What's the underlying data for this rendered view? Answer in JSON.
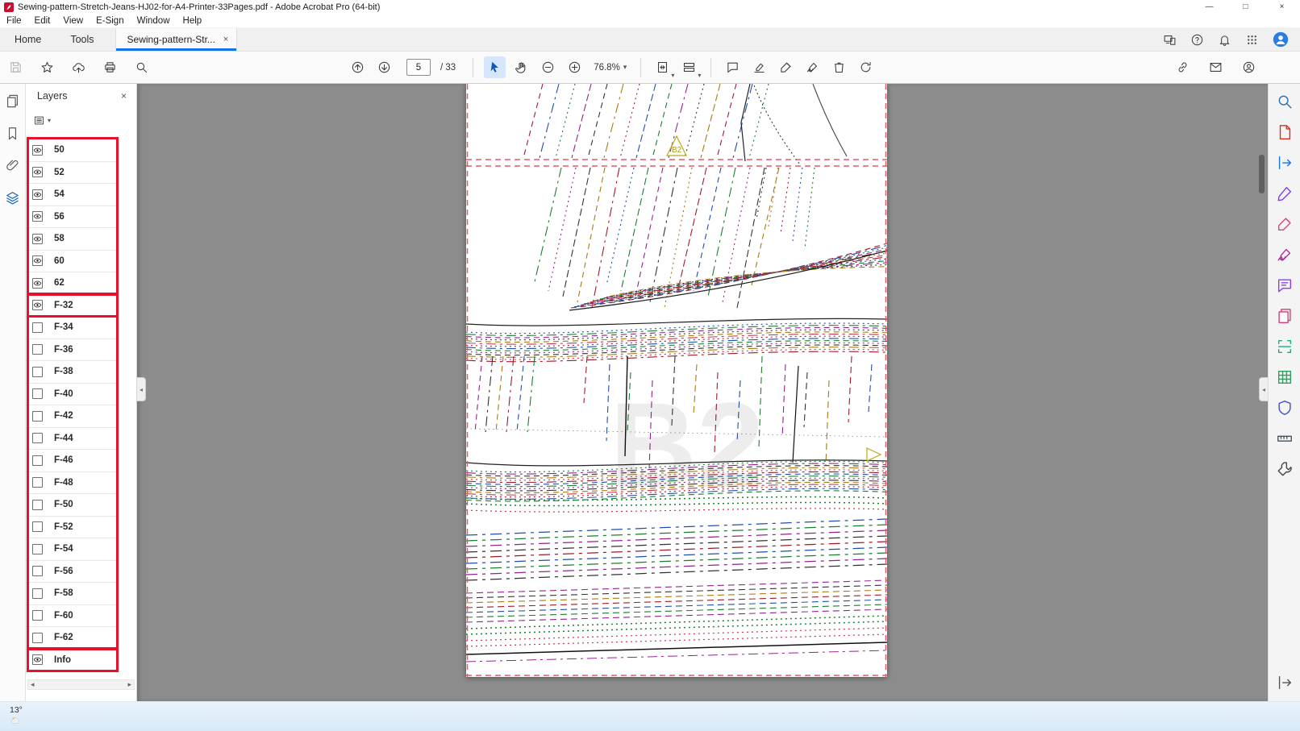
{
  "window": {
    "title": "Sewing-pattern-Stretch-Jeans-HJ02-for-A4-Printer-33Pages.pdf - Adobe Acrobat Pro (64-bit)",
    "controls": {
      "minimize": "—",
      "maximize": "□",
      "close": "×"
    }
  },
  "glyphs": {
    "caret_down": "▾",
    "collapse_left": "◂",
    "scroll_left": "◂",
    "scroll_right": "▸",
    "close": "×"
  },
  "menu_bar": {
    "items": [
      "File",
      "Edit",
      "View",
      "E-Sign",
      "Window",
      "Help"
    ]
  },
  "tab_bar": {
    "home_label": "Home",
    "tools_label": "Tools",
    "document_tab": "Sewing-pattern-Str...",
    "right_icons": [
      {
        "name": "devices-icon",
        "icon": "devices"
      },
      {
        "name": "help-icon",
        "icon": "help"
      },
      {
        "name": "notifications-bell-icon",
        "icon": "bell"
      },
      {
        "name": "apps-grid-icon",
        "icon": "grid9"
      },
      {
        "name": "user-avatar",
        "icon": "avatar"
      }
    ]
  },
  "toolbar": {
    "left_icons": [
      {
        "name": "save-button",
        "icon": "floppy",
        "disabled": true
      },
      {
        "name": "favorites-star-button",
        "icon": "star"
      },
      {
        "name": "share-cloud-button",
        "icon": "cloudup"
      },
      {
        "name": "print-button",
        "icon": "printer"
      },
      {
        "name": "find-button",
        "icon": "magnifier"
      }
    ],
    "nav": {
      "previous": {
        "name": "previous-page-button",
        "icon": "upcircle"
      },
      "next": {
        "name": "next-page-button",
        "icon": "downcircle"
      },
      "current_page": "5",
      "total_pages": "/ 33"
    },
    "tools": [
      {
        "name": "select-tool-button",
        "icon": "cursor",
        "active": true
      },
      {
        "name": "hand-tool-button",
        "icon": "hand"
      },
      {
        "name": "zoom-out-button",
        "icon": "minuscircle"
      },
      {
        "name": "zoom-in-button",
        "icon": "pluscircle"
      }
    ],
    "zoom_level": "76.8%",
    "view_icons": [
      {
        "name": "fit-width-button",
        "icon": "fitpage",
        "caret": true
      },
      {
        "name": "page-display-button",
        "icon": "rows",
        "caret": true
      }
    ],
    "action_icons": [
      {
        "name": "add-comment-button",
        "icon": "comment"
      },
      {
        "name": "highlight-button",
        "icon": "highlighter"
      },
      {
        "name": "sign-button",
        "icon": "signpen"
      },
      {
        "name": "draw-button",
        "icon": "inkpen"
      },
      {
        "name": "delete-button",
        "icon": "trash"
      },
      {
        "name": "rotate-page-button",
        "icon": "rotate"
      }
    ],
    "right_icons": [
      {
        "name": "link-button",
        "icon": "link"
      },
      {
        "name": "email-button",
        "icon": "envelope"
      },
      {
        "name": "assistant-button",
        "icon": "personcircle"
      }
    ]
  },
  "left_rail": {
    "items": [
      {
        "name": "page-thumbnails-icon",
        "icon": "pages"
      },
      {
        "name": "bookmarks-icon",
        "icon": "bookmark"
      },
      {
        "name": "attachments-icon",
        "icon": "paperclip"
      },
      {
        "name": "layers-icon",
        "icon": "layers",
        "active": true
      }
    ]
  },
  "right_rail": {
    "items": [
      {
        "name": "search-tools-icon",
        "icon": "magnifier",
        "color": "#2b6cb0"
      },
      {
        "name": "create-pdf-icon",
        "icon": "doc",
        "color": "#e02a1a"
      },
      {
        "name": "export-pdf-icon",
        "icon": "exportarrow",
        "color": "#1473e6"
      },
      {
        "name": "edit-pdf-icon",
        "icon": "pen",
        "color": "#7a3df0"
      },
      {
        "name": "request-signatures-icon",
        "icon": "signpen",
        "color": "#e4407a"
      },
      {
        "name": "fill-sign-icon",
        "icon": "inkpen",
        "color": "#b02ca0"
      },
      {
        "name": "comment-icon",
        "icon": "chat",
        "color": "#8a3ffc"
      },
      {
        "name": "organize-pages-icon",
        "icon": "pages",
        "color": "#d23f77"
      },
      {
        "name": "scan-ocr-icon",
        "icon": "scanner",
        "color": "#1bab7f"
      },
      {
        "name": "convert-table-icon",
        "icon": "gridtable",
        "color": "#2e9e5b"
      },
      {
        "name": "protect-icon",
        "icon": "shield",
        "color": "#3b4ccc"
      },
      {
        "name": "measure-icon",
        "icon": "ruler",
        "color": "#47525e"
      },
      {
        "name": "more-tools-icon",
        "icon": "wrench",
        "color": "#444444"
      }
    ],
    "bottom": {
      "name": "share-file-icon",
      "icon": "exportarrow",
      "color": "#555555"
    }
  },
  "layers_panel": {
    "title": "Layers",
    "layers": [
      {
        "label": "50",
        "visible": true
      },
      {
        "label": "52",
        "visible": true
      },
      {
        "label": "54",
        "visible": true
      },
      {
        "label": "56",
        "visible": true
      },
      {
        "label": "58",
        "visible": true
      },
      {
        "label": "60",
        "visible": true
      },
      {
        "label": "62",
        "visible": true
      },
      {
        "label": "F-32",
        "visible": true
      },
      {
        "label": "F-34",
        "visible": false
      },
      {
        "label": "F-36",
        "visible": false
      },
      {
        "label": "F-38",
        "visible": false
      },
      {
        "label": "F-40",
        "visible": false
      },
      {
        "label": "F-42",
        "visible": false
      },
      {
        "label": "F-44",
        "visible": false
      },
      {
        "label": "F-46",
        "visible": false
      },
      {
        "label": "F-48",
        "visible": false
      },
      {
        "label": "F-50",
        "visible": false
      },
      {
        "label": "F-52",
        "visible": false
      },
      {
        "label": "F-54",
        "visible": false
      },
      {
        "label": "F-56",
        "visible": false
      },
      {
        "label": "F-58",
        "visible": false
      },
      {
        "label": "F-60",
        "visible": false
      },
      {
        "label": "F-62",
        "visible": false
      },
      {
        "label": "Info",
        "visible": true
      }
    ]
  },
  "annotations": {
    "color": "#e8112d",
    "boxes": [
      {
        "first": 0,
        "last": 6
      },
      {
        "first": 7,
        "last": 22,
        "divider_after_first": true
      },
      {
        "first": 23,
        "last": 23
      }
    ]
  },
  "document": {
    "watermark": "B2",
    "tile_marker": "B2"
  },
  "taskbar": {
    "temperature": "13°"
  }
}
